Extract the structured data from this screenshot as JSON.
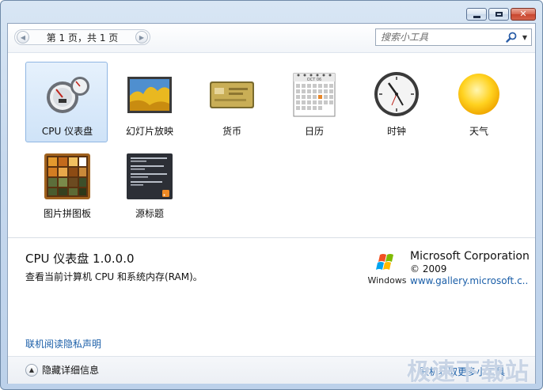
{
  "pager": {
    "text": "第 1 页，共 1 页"
  },
  "search": {
    "placeholder": "搜索小工具"
  },
  "gadgets": [
    {
      "name": "CPU 仪表盘",
      "icon": "cpu-meter-icon",
      "selected": true
    },
    {
      "name": "幻灯片放映",
      "icon": "slideshow-icon",
      "selected": false
    },
    {
      "name": "货币",
      "icon": "currency-icon",
      "selected": false
    },
    {
      "name": "日历",
      "icon": "calendar-icon",
      "selected": false
    },
    {
      "name": "时钟",
      "icon": "clock-icon",
      "selected": false
    },
    {
      "name": "天气",
      "icon": "weather-icon",
      "selected": false
    },
    {
      "name": "图片拼图板",
      "icon": "picture-puzzle-icon",
      "selected": false
    },
    {
      "name": "源标题",
      "icon": "feed-headlines-icon",
      "selected": false
    }
  ],
  "details": {
    "title": "CPU 仪表盘 1.0.0.0",
    "description": "查看当前计算机 CPU 和系统内存(RAM)。"
  },
  "publisher": {
    "name": "Microsoft Corporation",
    "copyright": "© 2009",
    "url": "www.gallery.microsoft.c...",
    "logo_text": "Windows"
  },
  "calendar_icon": {
    "month": "OCT 06"
  },
  "links": {
    "privacy": "联机阅读隐私声明",
    "more_gadgets": "联机获取更多小工具"
  },
  "footer": {
    "toggle_label": "隐藏详细信息"
  },
  "watermark": "极速下载站",
  "colors": {
    "selection": "#cfe3f8",
    "link": "#1a5ea8"
  }
}
